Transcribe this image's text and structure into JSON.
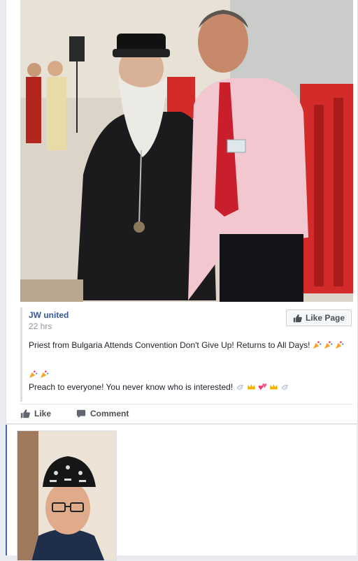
{
  "post": {
    "author": "JW united",
    "time": "22 hrs",
    "like_page_label": "Like Page",
    "text_line1": "Priest from Bulgaria Attends Convention Don't Give Up! Returns to All Days!",
    "text_line3": "Preach to everyone! You never know who is interested!",
    "actions": {
      "like": "Like",
      "comment": "Comment"
    }
  },
  "colors": {
    "link": "#365899",
    "accent": "#4267b2",
    "muted": "#90949c"
  },
  "icons": [
    "party-popper-icon",
    "crown-icon",
    "hearts-icon",
    "dove-icon",
    "thumbs-up-icon",
    "comment-icon"
  ]
}
